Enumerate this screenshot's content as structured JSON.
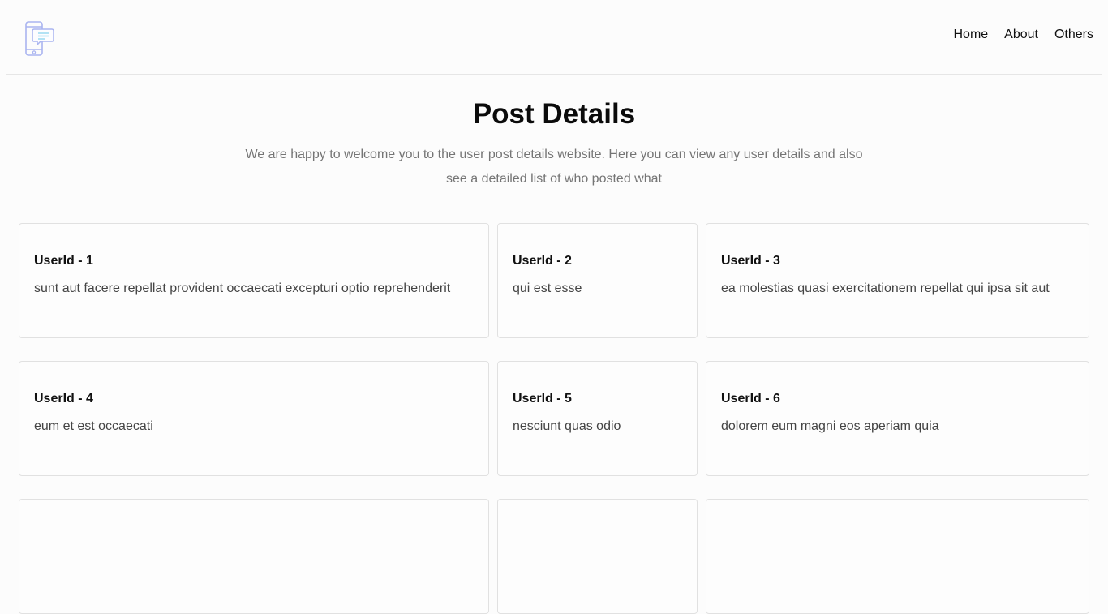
{
  "nav": {
    "items": [
      "Home",
      "About",
      "Others"
    ]
  },
  "hero": {
    "title": "Post Details",
    "subtitle": "We are happy to welcome you to the user post details website. Here you can view any user details and also see a detailed list of who posted what"
  },
  "posts": [
    {
      "user": "UserId - 1",
      "title": "sunt aut facere repellat provident occaecati excepturi optio reprehenderit"
    },
    {
      "user": "UserId - 2",
      "title": "qui est esse"
    },
    {
      "user": "UserId - 3",
      "title": "ea molestias quasi exercitationem repellat qui ipsa sit aut"
    },
    {
      "user": "UserId - 4",
      "title": "eum et est occaecati"
    },
    {
      "user": "UserId - 5",
      "title": "nesciunt quas odio"
    },
    {
      "user": "UserId - 6",
      "title": "dolorem eum magni eos aperiam quia"
    },
    {
      "user": "",
      "title": ""
    },
    {
      "user": "",
      "title": ""
    },
    {
      "user": "",
      "title": ""
    }
  ],
  "colors": {
    "logo_accent": "#a9b4f0",
    "logo_bubble": "#9fdcf2",
    "muted_text": "#757575",
    "border": "#e1e1e1"
  }
}
